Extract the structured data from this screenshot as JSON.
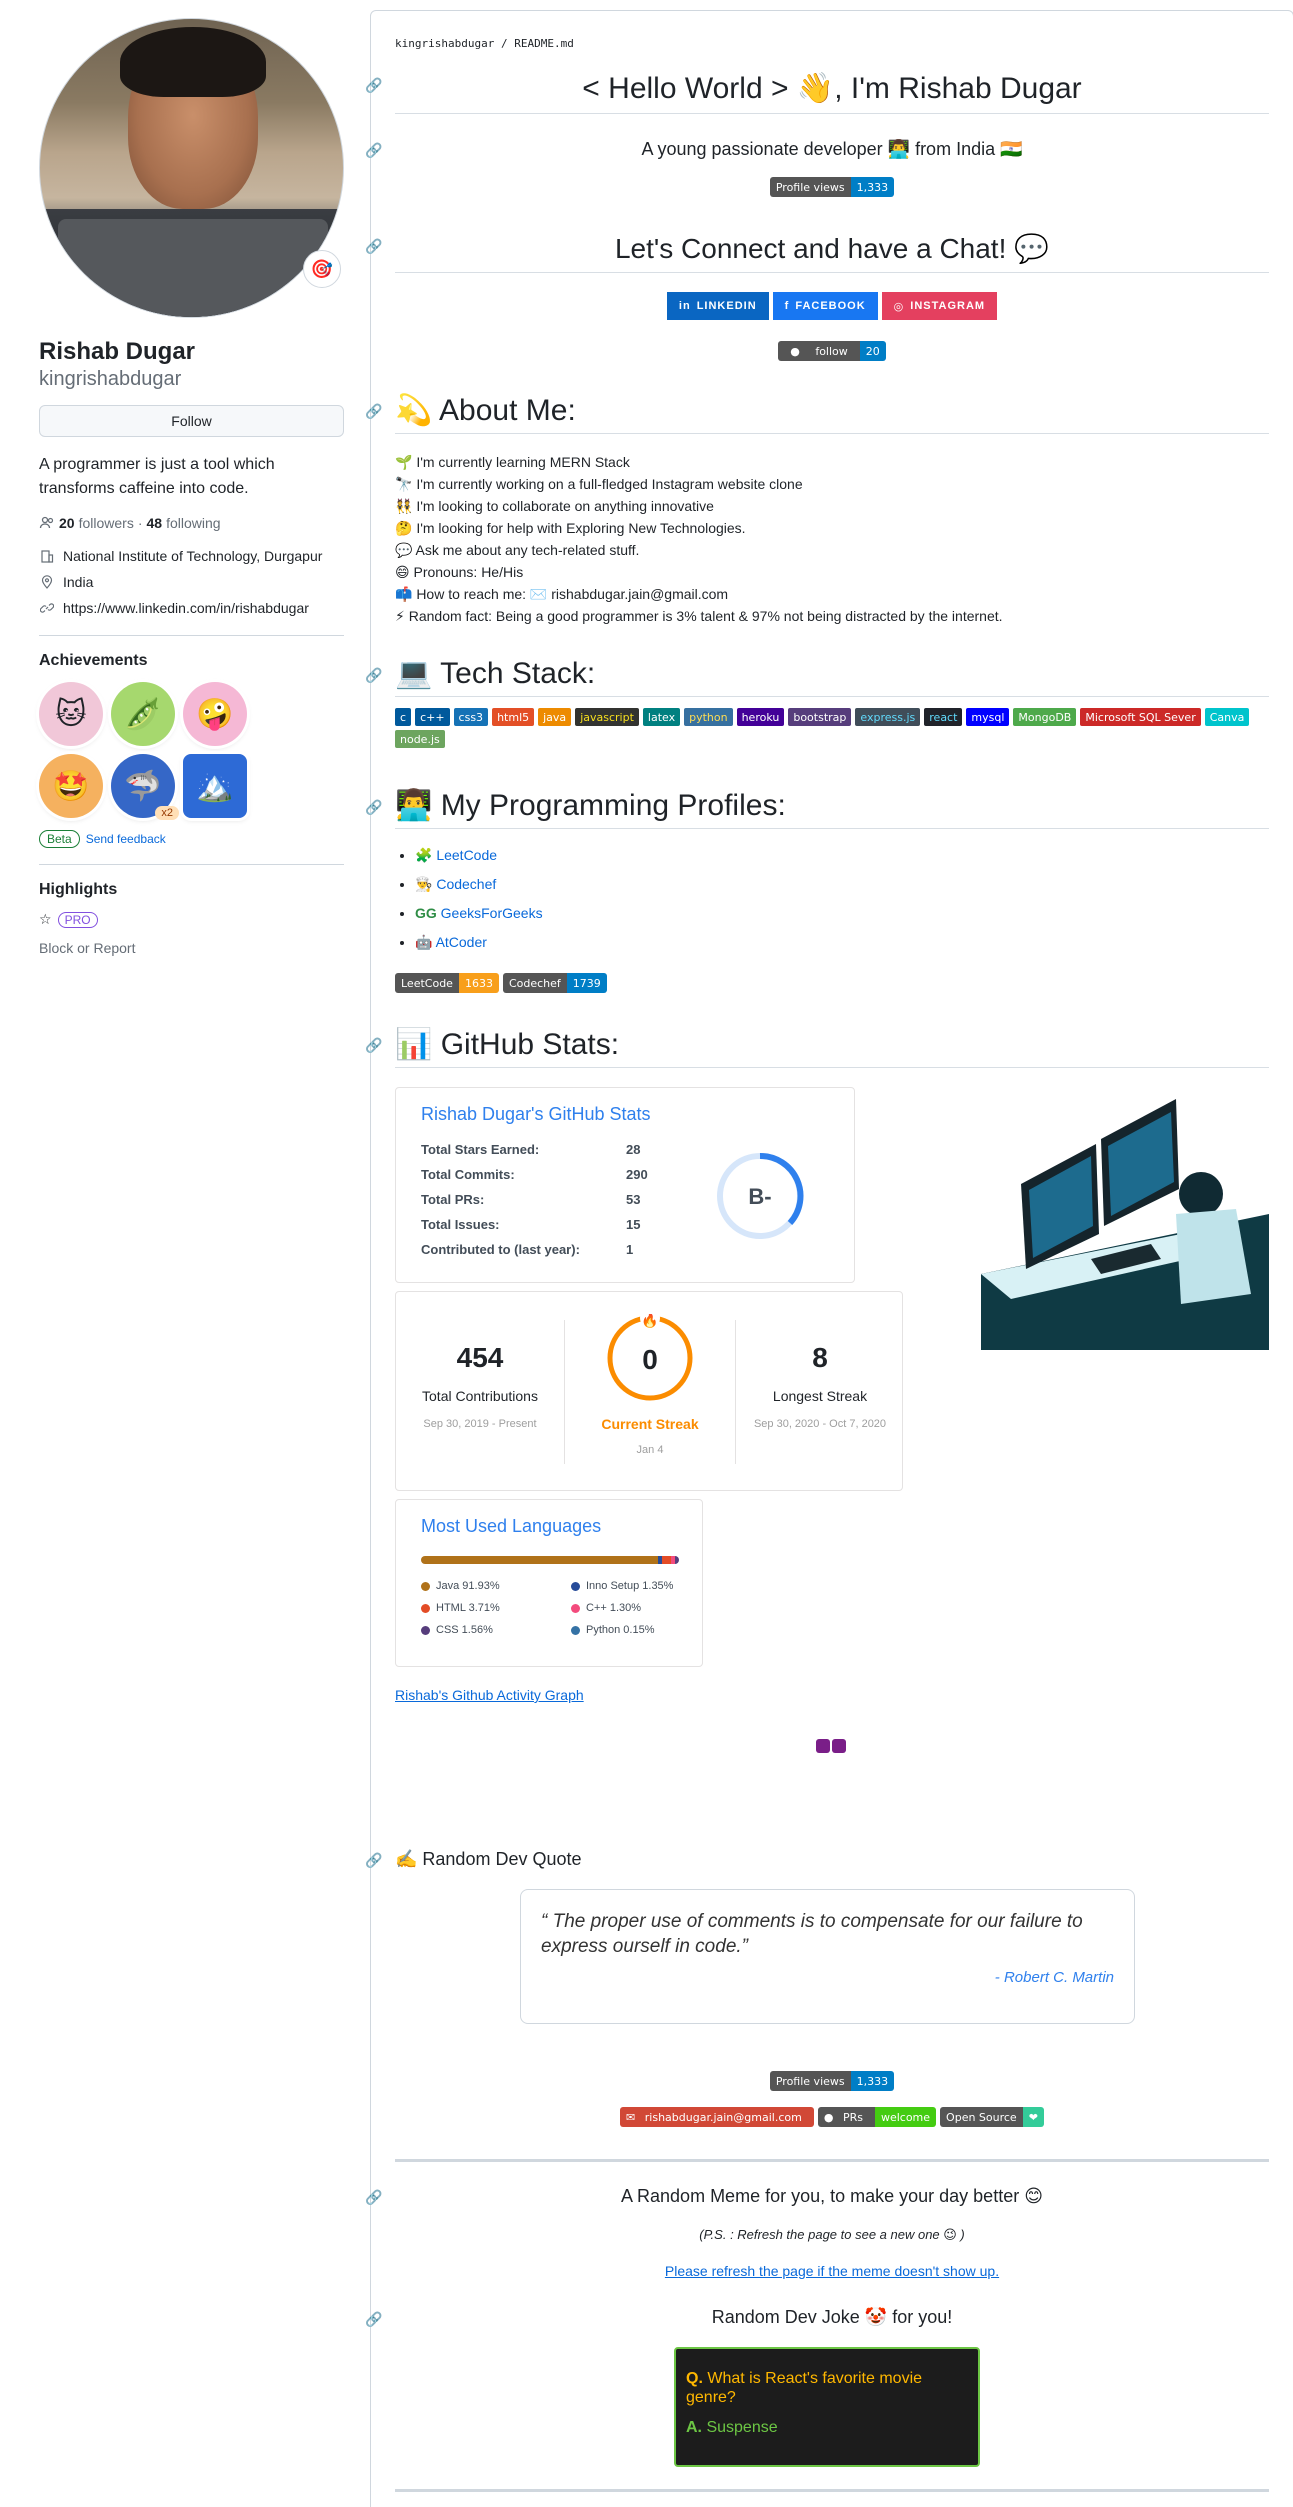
{
  "profile": {
    "name": "Rishab Dugar",
    "login": "kingrishabdugar",
    "follow_label": "Follow",
    "bio": "A programmer is just a tool which transforms caffeine into code.",
    "followers_count": "20",
    "followers_label": "followers",
    "following_count": "48",
    "following_label": "following",
    "organization": "National Institute of Technology, Durgapur",
    "location": "India",
    "website": "https://www.linkedin.com/in/rishabdugar",
    "achievements_title": "Achievements",
    "achievement_multiplier": "x2",
    "beta_label": "Beta",
    "feedback_label": "Send feedback",
    "highlights_title": "Highlights",
    "pro_label": "PRO",
    "block_label": "Block or Report"
  },
  "readme": {
    "path_user": "kingrishabdugar",
    "path_sep": "/",
    "path_file": "README.md",
    "hello_title": "< Hello World > 👋, I'm Rishab Dugar",
    "subtitle": "A young passionate developer 👨‍💻 from India 🇮🇳",
    "profile_views_label": "Profile views",
    "profile_views_value": "1,333",
    "connect_title": "Let's Connect and have a Chat! 💬",
    "social": [
      "LINKEDIN",
      "FACEBOOK",
      "INSTAGRAM"
    ],
    "follow_badge_label": "follow",
    "follow_badge_value": "20",
    "about_title": "💫 About Me:",
    "about_items": [
      "🌱 I'm currently learning MERN Stack",
      "🔭 I'm currently working on a full-fledged Instagram website clone",
      "👯 I'm looking to collaborate on anything innovative",
      "🤔 I'm looking for help with Exploring New Technologies.",
      "💬 Ask me about any tech-related stuff.",
      "😄 Pronouns: He/His",
      "📫 How to reach me: ✉️ rishabdugar.jain@gmail.com",
      "⚡ Random fact: Being a good programmer is 3% talent & 97% not being distracted by the internet."
    ],
    "tech_title": "💻 Tech Stack:",
    "tech": [
      "c",
      "c++",
      "css3",
      "html5",
      "java",
      "javascript",
      "latex",
      "python",
      "heroku",
      "bootstrap",
      "express.js",
      "react",
      "mysql",
      "MongoDB",
      "Microsoft SQL Sever",
      "Canva",
      "node.js"
    ],
    "profiles_title": "👨‍💻 My Programming Profiles:",
    "profiles": [
      "LeetCode",
      "Codechef",
      "GeeksForGeeks",
      "AtCoder"
    ],
    "leetcode_label": "LeetCode",
    "leetcode_value": "1633",
    "codechef_label": "Codechef",
    "codechef_value": "1739",
    "stats_title": "📊 GitHub Stats:",
    "stats_card_title": "Rishab Dugar's GitHub Stats",
    "stats_rows": [
      {
        "label": "Total Stars Earned:",
        "value": "28"
      },
      {
        "label": "Total Commits:",
        "value": "290"
      },
      {
        "label": "Total PRs:",
        "value": "53"
      },
      {
        "label": "Total Issues:",
        "value": "15"
      },
      {
        "label": "Contributed to (last year):",
        "value": "1"
      }
    ],
    "grade": "B-",
    "streak": {
      "total": "454",
      "total_label": "Total Contributions",
      "total_range": "Sep 30, 2019 - Present",
      "current": "0",
      "current_label": "Current Streak",
      "current_date": "Jan 4",
      "longest": "8",
      "longest_label": "Longest Streak",
      "longest_range": "Sep 30, 2020 - Oct 7, 2020"
    },
    "langs_title": "Most Used Languages",
    "langs": [
      {
        "name": "Java 91.93%",
        "color": "#b07219",
        "pct": 91.93
      },
      {
        "name": "Inno Setup 1.35%",
        "color": "#264b99",
        "pct": 1.35
      },
      {
        "name": "HTML 3.71%",
        "color": "#e34c26",
        "pct": 3.71
      },
      {
        "name": "C++ 1.30%",
        "color": "#f34b7d",
        "pct": 1.3
      },
      {
        "name": "CSS 1.56%",
        "color": "#563d7c",
        "pct": 1.56
      },
      {
        "name": "Python 0.15%",
        "color": "#3572A5",
        "pct": 0.15
      }
    ],
    "activity_alt": "Rishab's Github Activity Graph",
    "quote_title": "✍️ Random Dev Quote",
    "quote_text": "The proper use of comments is to compensate for our failure to express ourself in code.",
    "quote_author": "- Robert C. Martin",
    "views2_label": "Profile views",
    "views2_value": "1,333",
    "mail_badge": "rishabdugar.jain@gmail.com",
    "prs_label": "PRs",
    "prs_value": "welcome",
    "opensource_label": "Open Source",
    "meme_title": "A Random Meme for you, to make your day better 😊",
    "meme_note": "(P.S. : Refresh the page to see a new one 😉 )",
    "meme_alt": "Please refresh the page if the meme doesn't show up.",
    "joke_title": "Random Dev Joke 🤡 for you!",
    "joke_q": "What is React's favorite movie genre?",
    "joke_a": "Suspense",
    "q_prefix": "Q.",
    "a_prefix": "A."
  }
}
